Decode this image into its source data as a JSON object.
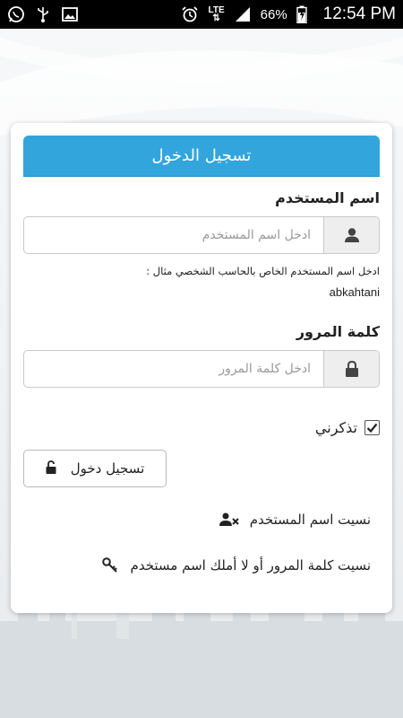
{
  "status_bar": {
    "icons_left": [
      "whatsapp-icon",
      "usb-icon",
      "image-icon"
    ],
    "lte": "LTE",
    "battery": "66%",
    "time": "12:54 PM"
  },
  "login": {
    "title": "تسجيل الدخول",
    "username_label": "اسم المستخدم",
    "username_placeholder": "ادخل اسم المستخدم",
    "username_hint": "ادخل اسم المستخدم الخاص بالحاسب الشخصي مثال :",
    "username_example": "abkahtani",
    "password_label": "كلمة المرور",
    "password_placeholder": "ادخل كلمة المرور",
    "remember_label": "تذكرني",
    "remember_checked": true,
    "login_button": "تسجيل دخول",
    "forgot_username": "نسيت اسم المستخدم",
    "forgot_password": "نسيت كلمة المرور أو لا أملك اسم مستخدم"
  },
  "colors": {
    "header": "#33a5dd",
    "status_bar": "#000000"
  }
}
